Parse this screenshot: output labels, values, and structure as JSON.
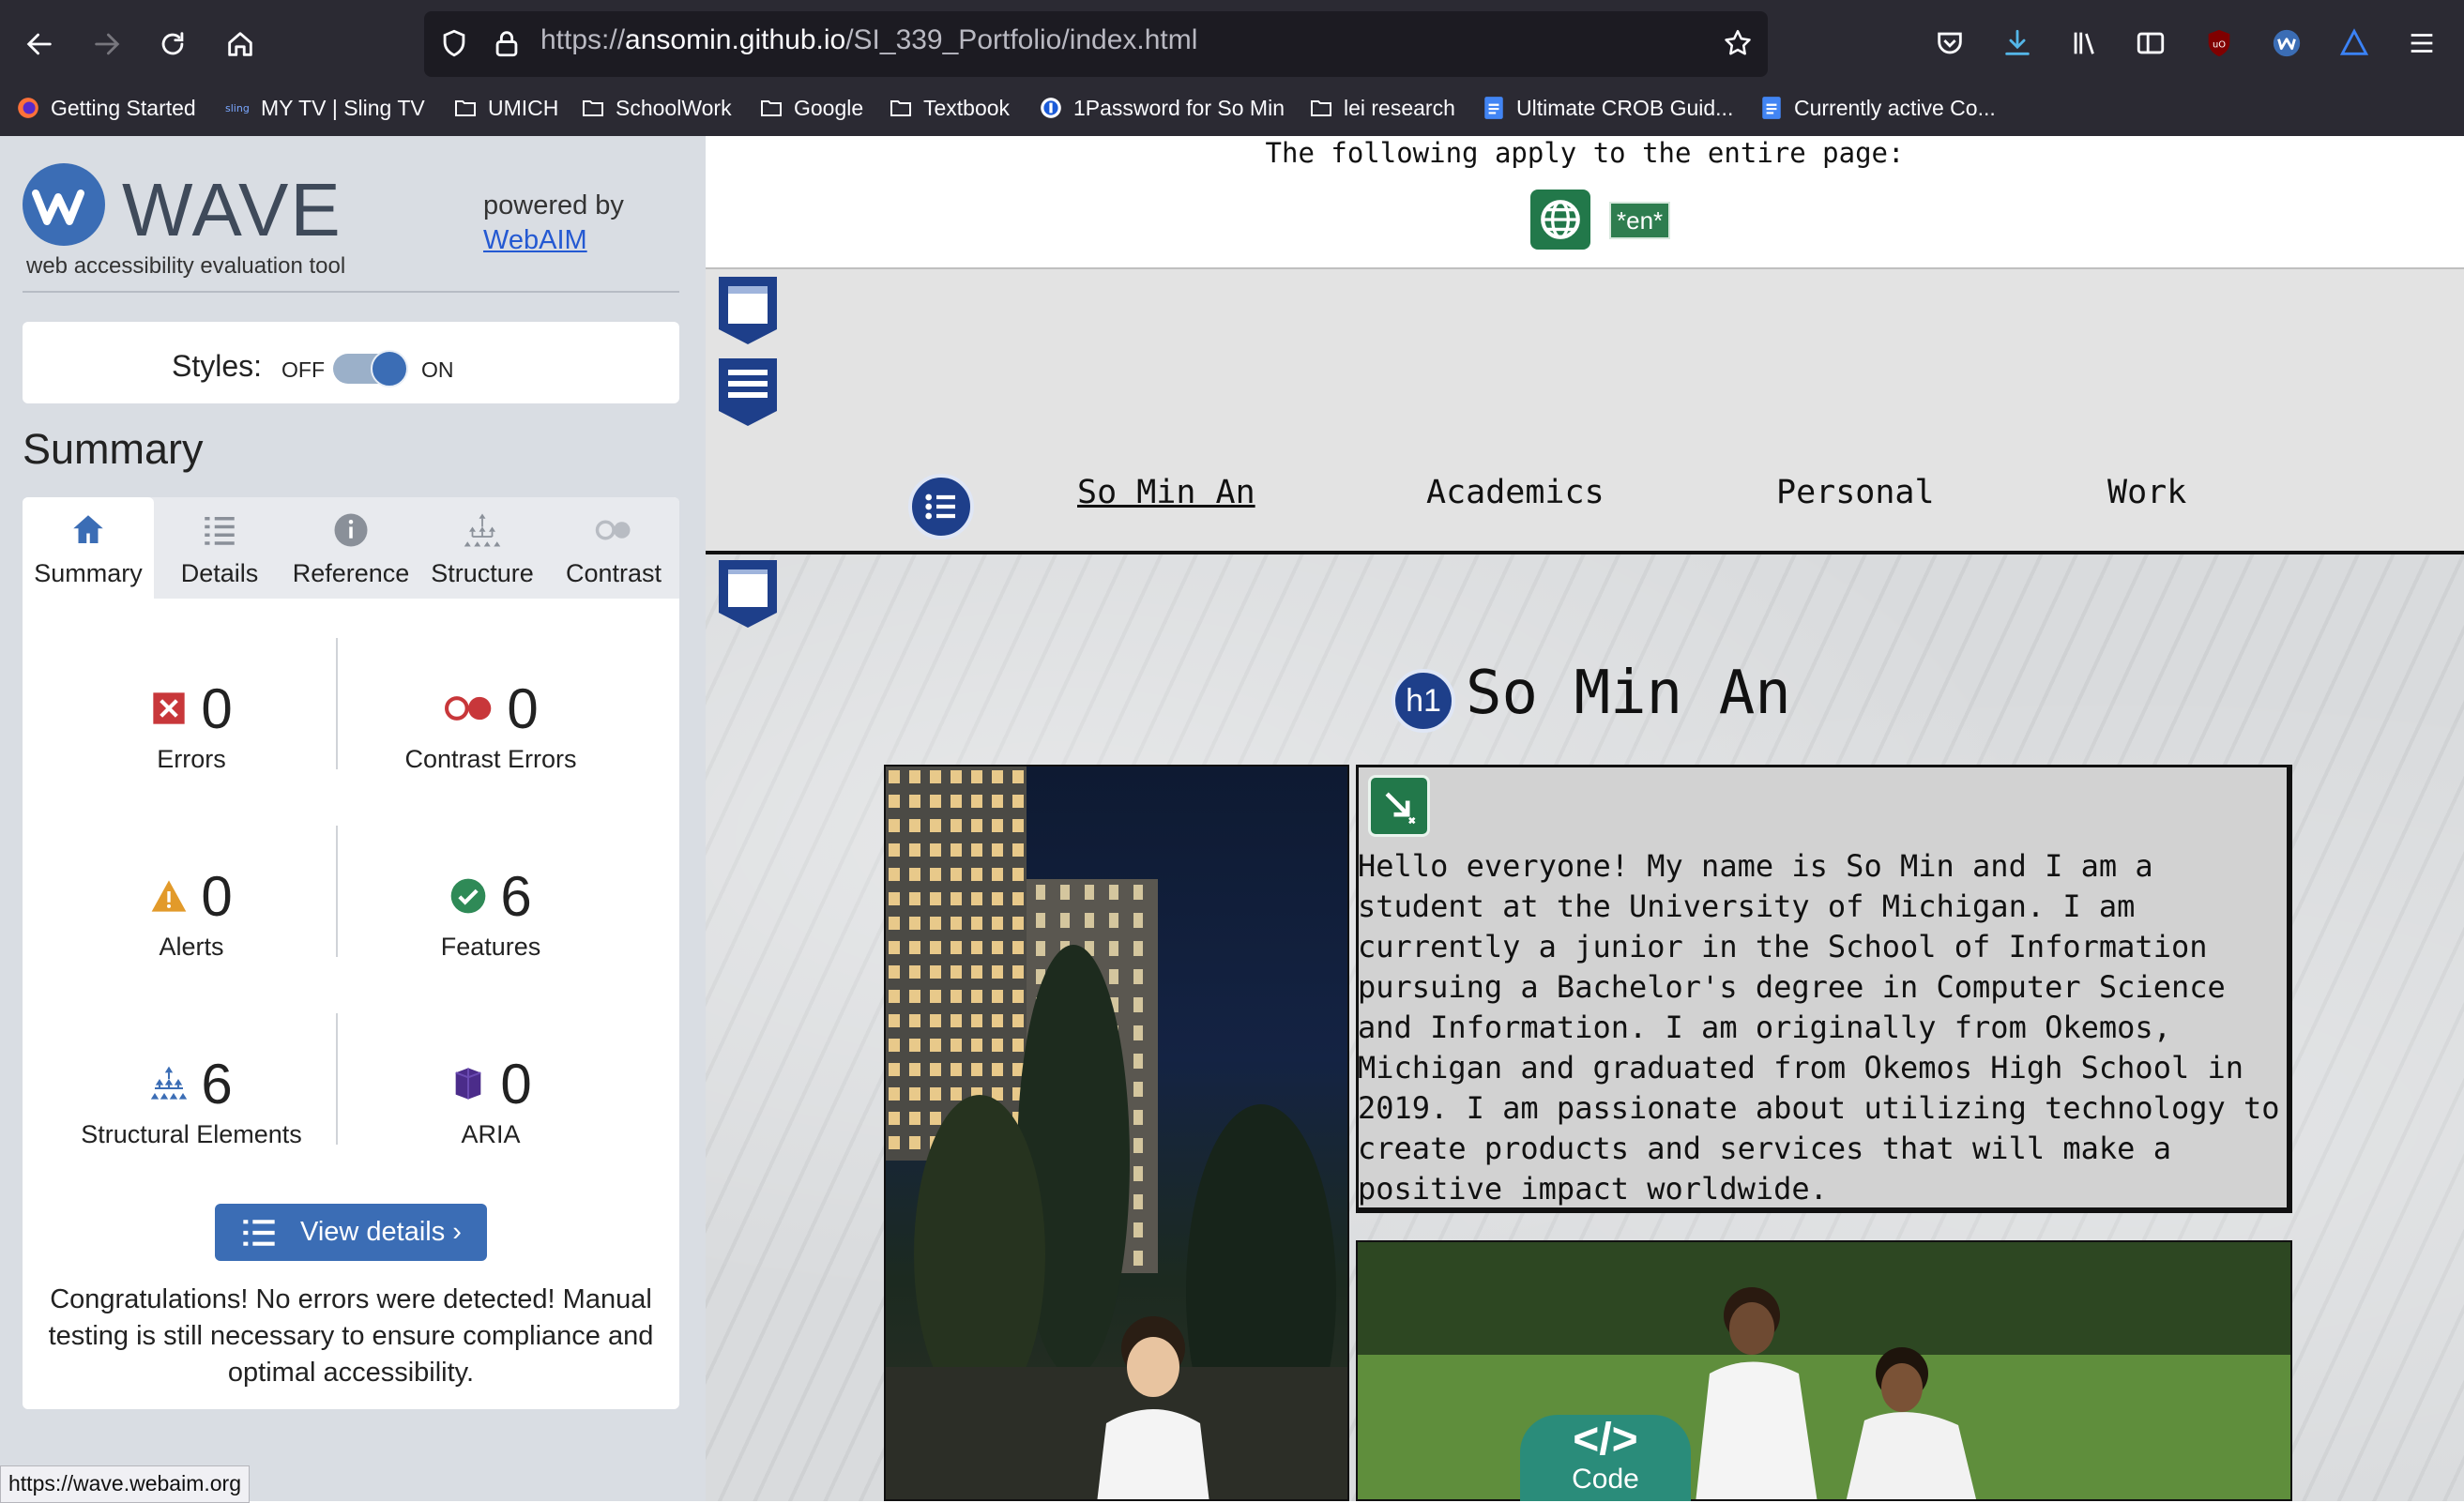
{
  "browser": {
    "url_prefix": "https://",
    "url_host": "ansomin.github.io",
    "url_path": "/SI_339_Portfolio/index.html",
    "bookmarks": [
      {
        "label": "Getting Started",
        "icon": "firefox-icon"
      },
      {
        "label": "MY TV | Sling TV",
        "icon": "sling-icon"
      },
      {
        "label": "UMICH",
        "icon": "folder-icon"
      },
      {
        "label": "SchoolWork",
        "icon": "folder-icon"
      },
      {
        "label": "Google",
        "icon": "folder-icon"
      },
      {
        "label": "Textbook",
        "icon": "folder-icon"
      },
      {
        "label": "1Password for So Min",
        "icon": "1password-icon"
      },
      {
        "label": "lei research",
        "icon": "folder-icon"
      },
      {
        "label": "Ultimate CROB Guid...",
        "icon": "google-docs-icon"
      },
      {
        "label": "Currently active Co...",
        "icon": "google-docs-icon"
      }
    ],
    "status_url": "https://wave.webaim.org"
  },
  "wave": {
    "title": "WAVE",
    "subtitle": "web accessibility evaluation tool",
    "powered_by": "powered by",
    "powered_link": "WebAIM",
    "styles_label": "Styles:",
    "styles_off": "OFF",
    "styles_on": "ON",
    "summary_heading": "Summary",
    "tabs": [
      {
        "label": "Summary",
        "icon": "home-icon"
      },
      {
        "label": "Details",
        "icon": "list-icon"
      },
      {
        "label": "Reference",
        "icon": "info-icon"
      },
      {
        "label": "Structure",
        "icon": "hierarchy-icon"
      },
      {
        "label": "Contrast",
        "icon": "contrast-icon"
      }
    ],
    "stats": {
      "errors": {
        "count": "0",
        "label": "Errors"
      },
      "contrast": {
        "count": "0",
        "label": "Contrast Errors"
      },
      "alerts": {
        "count": "0",
        "label": "Alerts"
      },
      "features": {
        "count": "6",
        "label": "Features"
      },
      "structural": {
        "count": "6",
        "label": "Structural Elements"
      },
      "aria": {
        "count": "0",
        "label": "ARIA"
      }
    },
    "view_details": "View details ›",
    "congrats": "Congratulations! No errors were detected! Manual testing is still necessary to ensure compliance and optimal accessibility."
  },
  "page": {
    "apply_text": "The following apply to the entire page:",
    "lang_tag": "*en*",
    "nav": [
      "So Min An",
      "Academics",
      "Personal",
      "Work"
    ],
    "h1_badge": "h1",
    "h1": "So Min An",
    "intro": "Hello everyone! My name is So Min and I am a student at the University of Michigan. I am currently a junior in the School of Information pursuing a Bachelor's degree in Computer Science and Information. I am originally from Okemos, Michigan and graduated from Okemos High School in 2019. I am passionate about utilizing technology to create products and services that will make a positive impact worldwide.",
    "code_glyph": "</>",
    "code_label": "Code"
  },
  "colors": {
    "chrome": "#2b2a33",
    "wave_blue": "#3b6db5",
    "feature_green": "#22784a",
    "error_red": "#c8373a",
    "alert_orange": "#e29a2a"
  }
}
